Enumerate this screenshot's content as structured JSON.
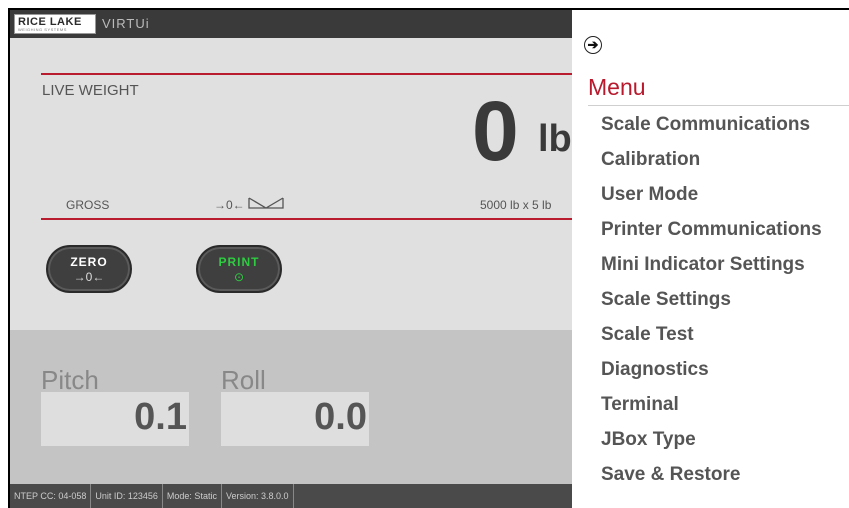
{
  "header": {
    "logo_text": "RICE LAKE",
    "logo_subtext": "WEIGHING SYSTEMS",
    "product_name": "VIRTUi"
  },
  "weight": {
    "label": "LIVE WEIGHT",
    "value": "0",
    "unit": "lb",
    "mode": "GROSS",
    "center_zero_symbol": "→0←",
    "capacity": "5000 lb x 5 lb"
  },
  "buttons": {
    "zero_label": "ZERO",
    "zero_icon": "→0←",
    "print_label": "PRINT",
    "print_icon": "⊙"
  },
  "tilt": {
    "pitch_label": "Pitch",
    "pitch_value": "0.1",
    "roll_label": "Roll",
    "roll_value": "0.0"
  },
  "footer": {
    "ntep": "NTEP CC: 04-058",
    "unit_id": "Unit ID: 123456",
    "mode": "Mode: Static",
    "version": "Version: 3.8.0.0"
  },
  "menu": {
    "close_icon": "➔",
    "title": "Menu",
    "items": [
      "Scale Communications",
      "Calibration",
      "User Mode",
      "Printer Communications",
      "Mini Indicator Settings",
      "Scale Settings",
      "Scale Test",
      "Diagnostics",
      "Terminal",
      "JBox Type",
      "Save & Restore"
    ]
  },
  "colors": {
    "accent_red": "#b91c2e",
    "menu_title_red": "#b8192c",
    "print_green": "#2ecc40"
  }
}
